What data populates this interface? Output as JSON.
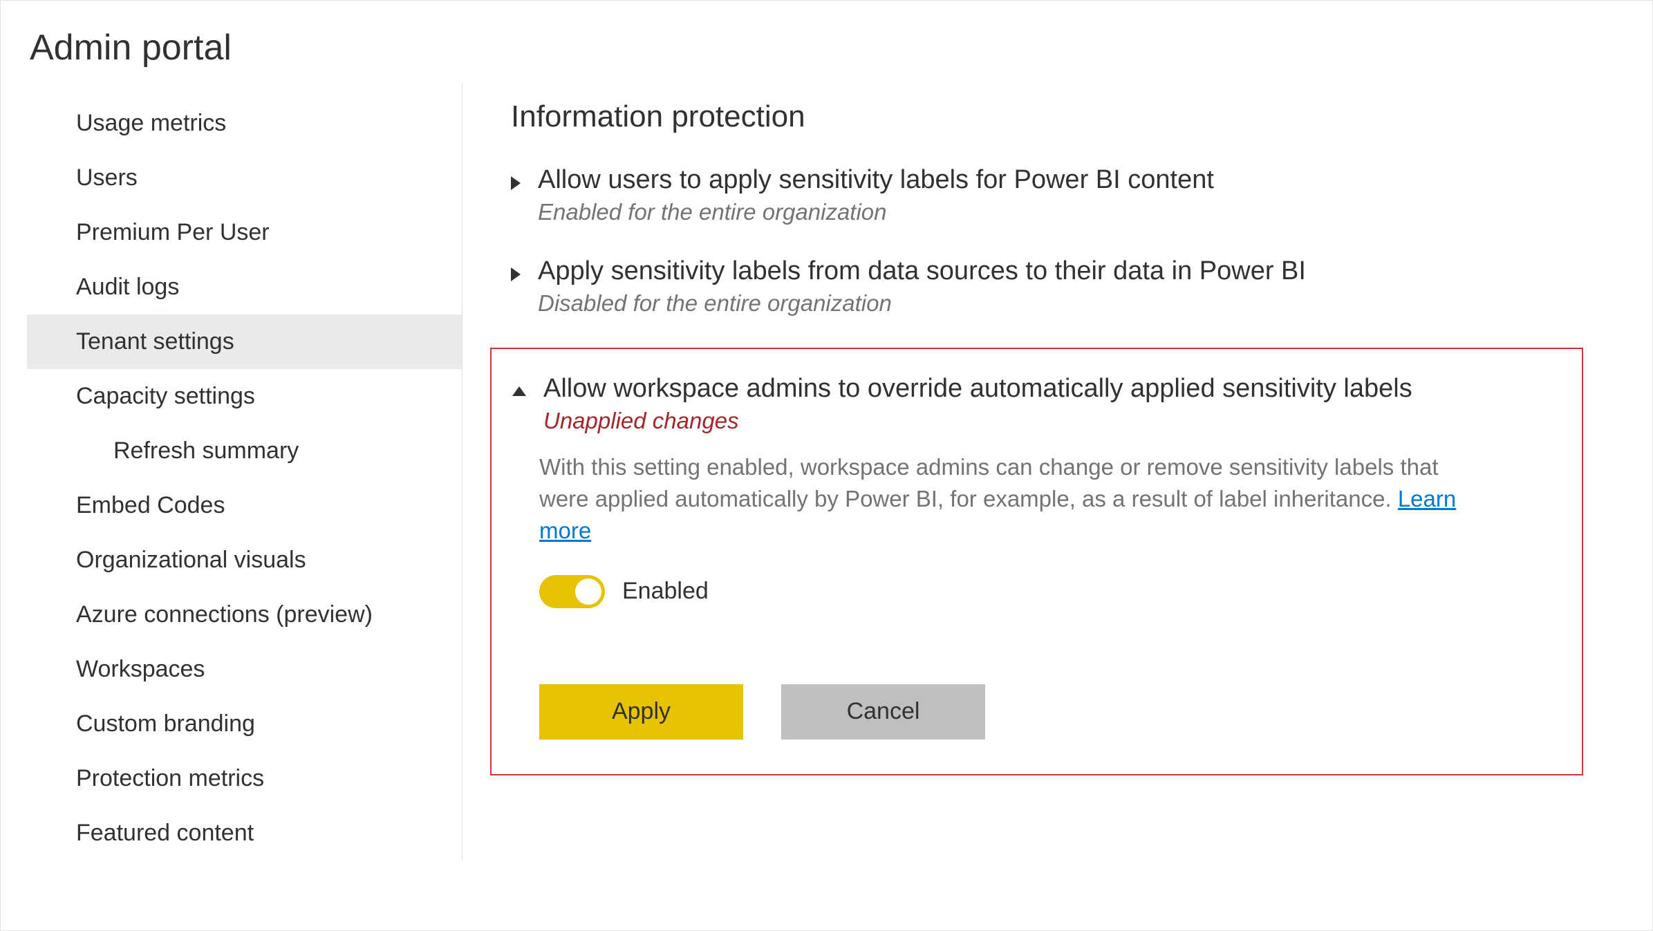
{
  "page": {
    "title": "Admin portal"
  },
  "sidebar": {
    "items": [
      {
        "label": "Usage metrics",
        "selected": false
      },
      {
        "label": "Users",
        "selected": false
      },
      {
        "label": "Premium Per User",
        "selected": false
      },
      {
        "label": "Audit logs",
        "selected": false
      },
      {
        "label": "Tenant settings",
        "selected": true
      },
      {
        "label": "Capacity settings",
        "selected": false,
        "subitems": [
          {
            "label": "Refresh summary"
          }
        ]
      },
      {
        "label": "Embed Codes",
        "selected": false
      },
      {
        "label": "Organizational visuals",
        "selected": false
      },
      {
        "label": "Azure connections (preview)",
        "selected": false
      },
      {
        "label": "Workspaces",
        "selected": false
      },
      {
        "label": "Custom branding",
        "selected": false
      },
      {
        "label": "Protection metrics",
        "selected": false
      },
      {
        "label": "Featured content",
        "selected": false
      }
    ]
  },
  "main": {
    "section_title": "Information protection",
    "settings": [
      {
        "title": "Allow users to apply sensitivity labels for Power BI content",
        "status": "Enabled for the entire organization",
        "expanded": false
      },
      {
        "title": "Apply sensitivity labels from data sources to their data in Power BI",
        "status": "Disabled for the entire organization",
        "expanded": false
      },
      {
        "title": "Allow workspace admins to override automatically applied sensitivity labels",
        "status": "Unapplied changes",
        "expanded": true,
        "highlighted": true,
        "description": "With this setting enabled, workspace admins can change or remove sensitivity labels that were applied automatically by Power BI, for example, as a result of label inheritance.",
        "learn_more": "Learn more",
        "toggle": {
          "enabled": true,
          "label": "Enabled"
        },
        "buttons": {
          "apply": "Apply",
          "cancel": "Cancel"
        }
      }
    ]
  }
}
